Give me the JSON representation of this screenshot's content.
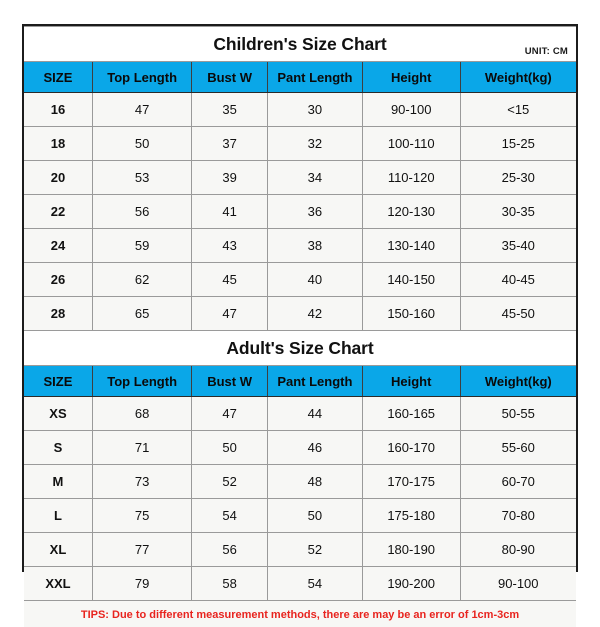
{
  "unit_label": "UNIT: CM",
  "columns": [
    "SIZE",
    "Top Length",
    "Bust W",
    "Pant Length",
    "Height",
    "Weight(kg)"
  ],
  "children": {
    "title": "Children's Size Chart",
    "rows": [
      {
        "size": "16",
        "top_length": "47",
        "bust_w": "35",
        "pant_length": "30",
        "height": "90-100",
        "weight": "<15"
      },
      {
        "size": "18",
        "top_length": "50",
        "bust_w": "37",
        "pant_length": "32",
        "height": "100-110",
        "weight": "15-25"
      },
      {
        "size": "20",
        "top_length": "53",
        "bust_w": "39",
        "pant_length": "34",
        "height": "110-120",
        "weight": "25-30"
      },
      {
        "size": "22",
        "top_length": "56",
        "bust_w": "41",
        "pant_length": "36",
        "height": "120-130",
        "weight": "30-35"
      },
      {
        "size": "24",
        "top_length": "59",
        "bust_w": "43",
        "pant_length": "38",
        "height": "130-140",
        "weight": "35-40"
      },
      {
        "size": "26",
        "top_length": "62",
        "bust_w": "45",
        "pant_length": "40",
        "height": "140-150",
        "weight": "40-45"
      },
      {
        "size": "28",
        "top_length": "65",
        "bust_w": "47",
        "pant_length": "42",
        "height": "150-160",
        "weight": "45-50"
      }
    ]
  },
  "adult": {
    "title": "Adult's Size Chart",
    "rows": [
      {
        "size": "XS",
        "top_length": "68",
        "bust_w": "47",
        "pant_length": "44",
        "height": "160-165",
        "weight": "50-55"
      },
      {
        "size": "S",
        "top_length": "71",
        "bust_w": "50",
        "pant_length": "46",
        "height": "160-170",
        "weight": "55-60"
      },
      {
        "size": "M",
        "top_length": "73",
        "bust_w": "52",
        "pant_length": "48",
        "height": "170-175",
        "weight": "60-70"
      },
      {
        "size": "L",
        "top_length": "75",
        "bust_w": "54",
        "pant_length": "50",
        "height": "175-180",
        "weight": "70-80"
      },
      {
        "size": "XL",
        "top_length": "77",
        "bust_w": "56",
        "pant_length": "52",
        "height": "180-190",
        "weight": "80-90"
      },
      {
        "size": "XXL",
        "top_length": "79",
        "bust_w": "58",
        "pant_length": "54",
        "height": "190-200",
        "weight": "90-100"
      }
    ]
  },
  "tips": "TIPS: Due to different measurement methods, there are may be an error of 1cm-3cm",
  "colors": {
    "header_blue": "#0aa7e8",
    "row_background": "#f7f7f5",
    "tips_red": "#e8241f",
    "border_dark": "#1c1c1c",
    "gridline": "#9a9a9a"
  }
}
